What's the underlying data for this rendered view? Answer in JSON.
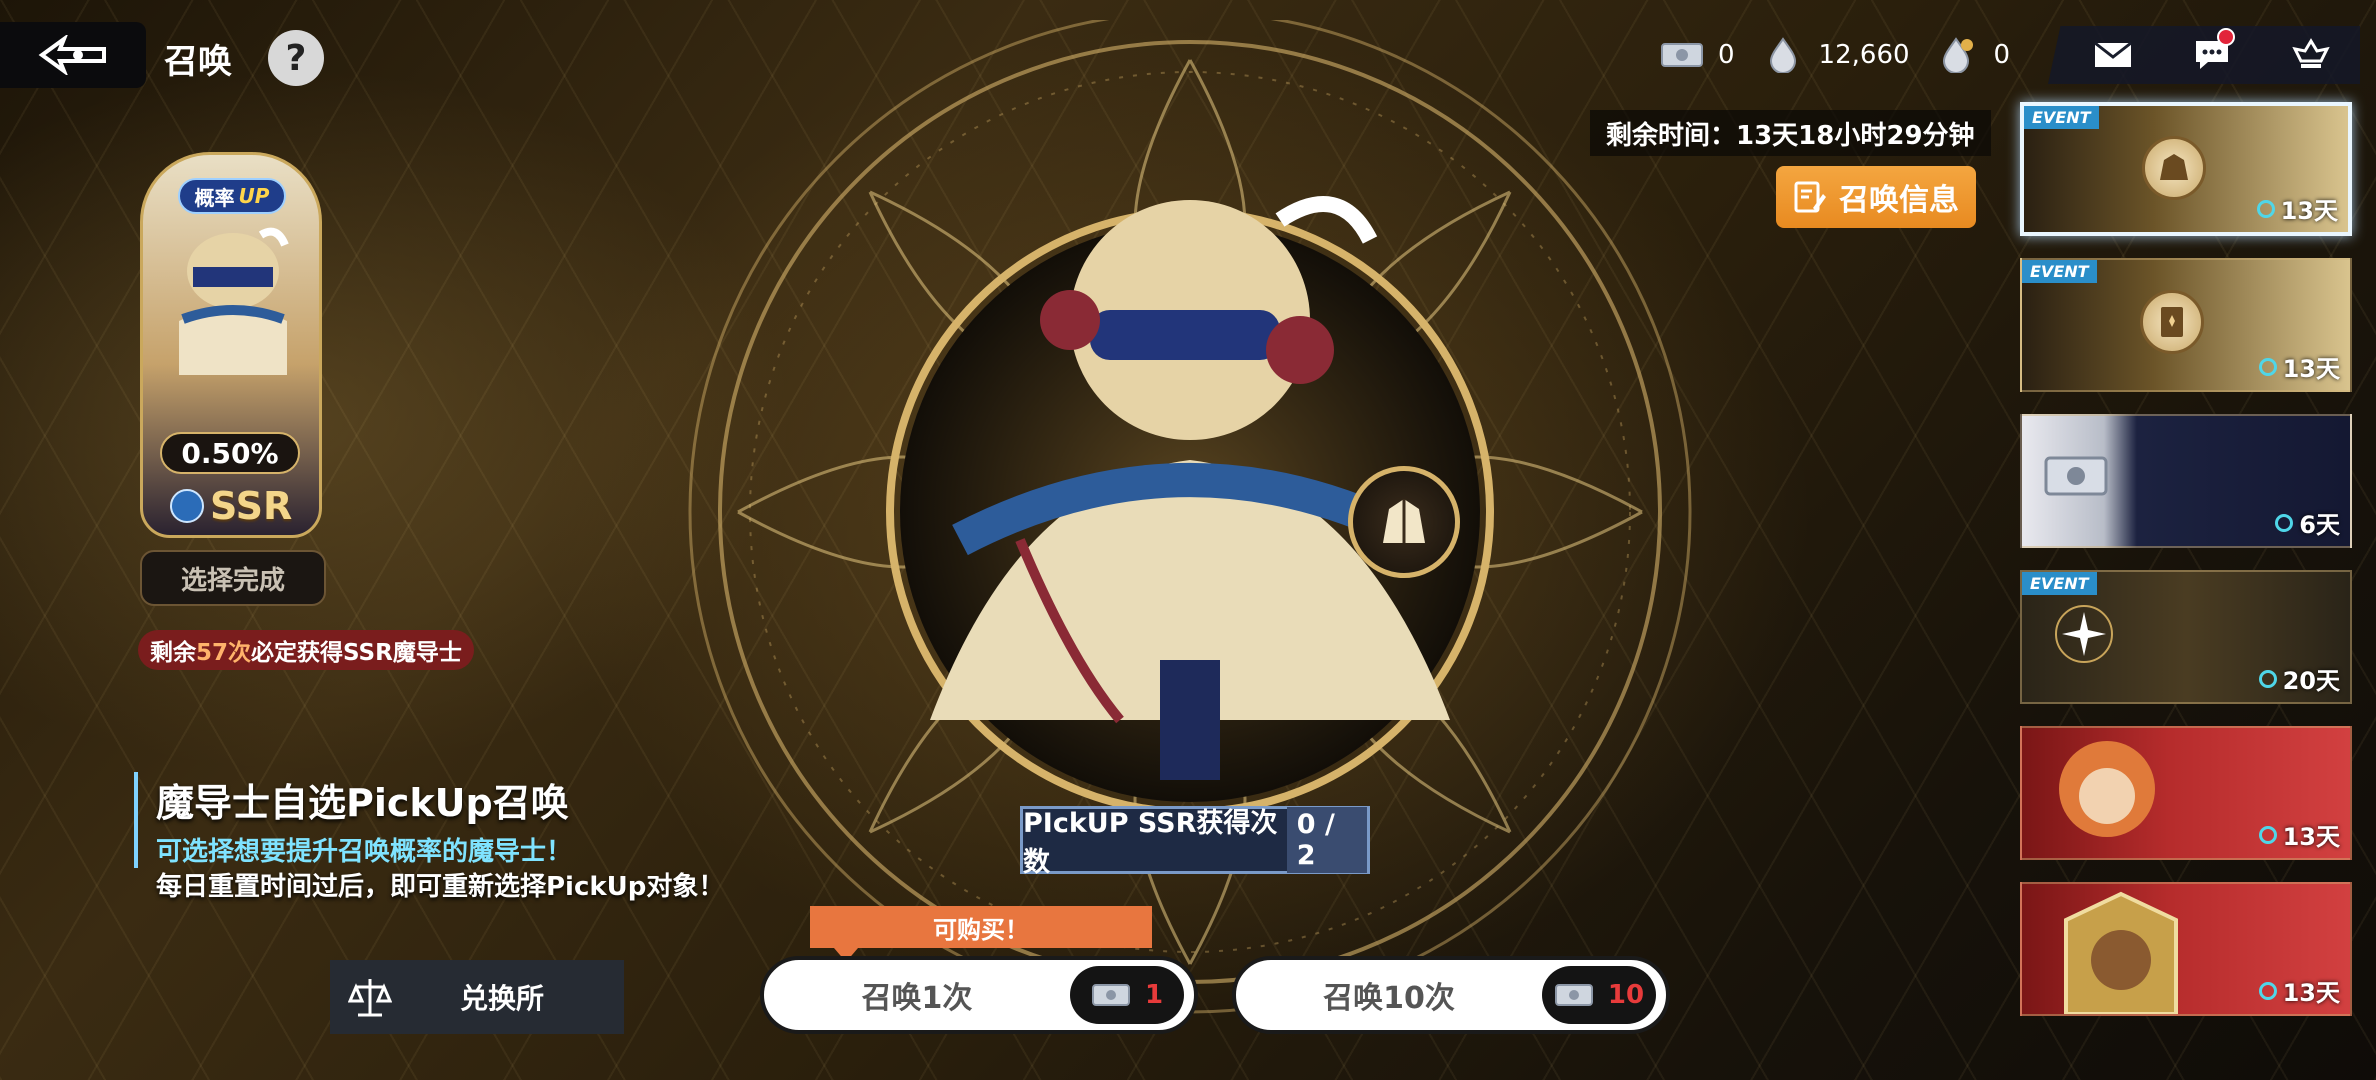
{
  "header": {
    "title": "召唤",
    "help_label": "?"
  },
  "currencies": [
    {
      "icon": "summon-ticket-icon",
      "value": "0"
    },
    {
      "icon": "mana-crystal-icon",
      "value": "12,660"
    },
    {
      "icon": "paid-crystal-icon",
      "value": "0"
    }
  ],
  "top_icons": [
    "mail-icon",
    "chat-icon",
    "guild-icon"
  ],
  "remaining_time": "剩余时间：13天18小时29分钟",
  "info_button": "召唤信息",
  "featured": {
    "rate_up_label": "概率",
    "rate_up_badge": "UP",
    "rate": "0.50%",
    "rarity": "SSR",
    "select_done": "选择完成",
    "pity": {
      "prefix": "剩余",
      "count": "57次",
      "suffix": "必定获得SSR魔导士"
    }
  },
  "banner_info": {
    "title": "魔导士自选PickUp召唤",
    "subtitle": "可选择想要提升召唤概率的魔导士！",
    "note": "每日重置时间过后，即可重新选择PickUp对象！"
  },
  "pickup_count": {
    "label": "PIckUP SSR获得次数",
    "value": "0 / 2"
  },
  "bottom": {
    "exchange": "兑换所",
    "buyable": "可购买！",
    "summon1": {
      "label": "召唤1次",
      "cost": "1"
    },
    "summon10": {
      "label": "召唤10次",
      "cost": "10"
    }
  },
  "banners": [
    {
      "tag": "EVENT",
      "days": "13天",
      "selected": true
    },
    {
      "tag": "EVENT",
      "days": "13天",
      "selected": false
    },
    {
      "tag": "",
      "days": "6天",
      "selected": false
    },
    {
      "tag": "EVENT",
      "days": "20天",
      "selected": false
    },
    {
      "tag": "",
      "days": "13天",
      "selected": false
    },
    {
      "tag": "",
      "days": "13天",
      "selected": false
    }
  ],
  "colors": {
    "accent_orange": "#e88a20",
    "cyan_text": "#7fe3ff",
    "pity_red": "#7a1d1d"
  }
}
